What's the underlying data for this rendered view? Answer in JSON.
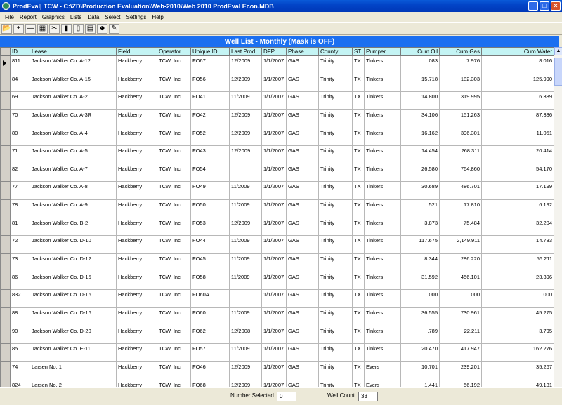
{
  "window": {
    "title": "ProdEval| TCW - C:\\ZD\\Production Evaluation\\Web-2010\\Web 2010 ProdEval Econ.MDB",
    "minimize": "_",
    "maximize": "□",
    "close": "×"
  },
  "menu": [
    "File",
    "Report",
    "Graphics",
    "Lists",
    "Data",
    "Select",
    "Settings",
    "Help"
  ],
  "toolbar": [
    {
      "icon": "open-folder-icon",
      "glyph": "📂"
    },
    {
      "icon": "add-icon",
      "glyph": "+"
    },
    {
      "icon": "remove-icon",
      "glyph": "—"
    },
    {
      "icon": "map-icon",
      "glyph": "▦"
    },
    {
      "icon": "tools-icon",
      "glyph": "✂"
    },
    {
      "icon": "book-icon",
      "glyph": "▮"
    },
    {
      "icon": "notebook-icon",
      "glyph": "▯"
    },
    {
      "icon": "card-icon",
      "glyph": "▤"
    },
    {
      "icon": "users-icon",
      "glyph": "☻"
    },
    {
      "icon": "wand-icon",
      "glyph": "✎"
    }
  ],
  "grid_title": "Well List - Monthly (Mask is OFF)",
  "columns": [
    "ID",
    "Lease",
    "Field",
    "Operator",
    "Unique ID",
    "Last Prod.",
    "DFP",
    "Phase",
    "County",
    "ST",
    "Pumper",
    "Cum Oil",
    "Cum Gas",
    "Cum Water"
  ],
  "rows": [
    [
      "811",
      "Jackson Walker Co. A-12",
      "Hackberry",
      "TCW, Inc",
      "FO67",
      "12/2009",
      "1/1/2007",
      "GAS",
      "Trinity",
      "TX",
      "Tinkers",
      ".083",
      "7.976",
      "8.016"
    ],
    [
      "84",
      "Jackson Walker Co. A-15",
      "Hackberry",
      "TCW, Inc",
      "FO56",
      "12/2009",
      "1/1/2007",
      "GAS",
      "Trinity",
      "TX",
      "Tinkers",
      "15.718",
      "182.303",
      "125.990"
    ],
    [
      "69",
      "Jackson Walker Co. A-2",
      "Hackberry",
      "TCW, Inc",
      "FO41",
      "11/2009",
      "1/1/2007",
      "GAS",
      "Trinity",
      "TX",
      "Tinkers",
      "14.800",
      "319.995",
      "6.389"
    ],
    [
      "70",
      "Jackson Walker Co. A-3R",
      "Hackberry",
      "TCW, Inc",
      "FO42",
      "12/2009",
      "1/1/2007",
      "GAS",
      "Trinity",
      "TX",
      "Tinkers",
      "34.106",
      "151.263",
      "87.336"
    ],
    [
      "80",
      "Jackson Walker Co. A-4",
      "Hackberry",
      "TCW, Inc",
      "FO52",
      "12/2009",
      "1/1/2007",
      "GAS",
      "Trinity",
      "TX",
      "Tinkers",
      "16.162",
      "396.301",
      "11.051"
    ],
    [
      "71",
      "Jackson Walker Co. A-5",
      "Hackberry",
      "TCW, Inc",
      "FO43",
      "12/2009",
      "1/1/2007",
      "GAS",
      "Trinity",
      "TX",
      "Tinkers",
      "14.454",
      "268.311",
      "20.414"
    ],
    [
      "82",
      "Jackson Walker Co. A-7",
      "Hackberry",
      "TCW, Inc",
      "FO54",
      "",
      "1/1/2007",
      "GAS",
      "Trinity",
      "TX",
      "Tinkers",
      "26.580",
      "764.860",
      "54.170"
    ],
    [
      "77",
      "Jackson Walker Co. A-8",
      "Hackberry",
      "TCW, Inc",
      "FO49",
      "11/2009",
      "1/1/2007",
      "GAS",
      "Trinity",
      "TX",
      "Tinkers",
      "30.689",
      "486.701",
      "17.199"
    ],
    [
      "78",
      "Jackson Walker Co. A-9",
      "Hackberry",
      "TCW, Inc",
      "FO50",
      "11/2009",
      "1/1/2007",
      "GAS",
      "Trinity",
      "TX",
      "Tinkers",
      ".521",
      "17.810",
      "6.192"
    ],
    [
      "81",
      "Jackson Walker Co. B-2",
      "Hackberry",
      "TCW, Inc",
      "FO53",
      "12/2009",
      "1/1/2007",
      "GAS",
      "Trinity",
      "TX",
      "Tinkers",
      "3.873",
      "75.484",
      "32.204"
    ],
    [
      "72",
      "Jackson Walker Co. D-10",
      "Hackberry",
      "TCW, Inc",
      "FO44",
      "11/2009",
      "1/1/2007",
      "GAS",
      "Trinity",
      "TX",
      "Tinkers",
      "117.675",
      "2,149.911",
      "14.733"
    ],
    [
      "73",
      "Jackson Walker Co. D-12",
      "Hackberry",
      "TCW, Inc",
      "FO45",
      "11/2009",
      "1/1/2007",
      "GAS",
      "Trinity",
      "TX",
      "Tinkers",
      "8.344",
      "286.220",
      "56.211"
    ],
    [
      "86",
      "Jackson Walker Co. D-15",
      "Hackberry",
      "TCW, Inc",
      "FO58",
      "11/2009",
      "1/1/2007",
      "GAS",
      "Trinity",
      "TX",
      "Tinkers",
      "31.592",
      "456.101",
      "23.396"
    ],
    [
      "832",
      "Jackson Walker Co. D-16",
      "Hackberry",
      "TCW, Inc",
      "FO60A",
      "",
      "1/1/2007",
      "GAS",
      "Trinity",
      "TX",
      "Tinkers",
      ".000",
      ".000",
      ".000"
    ],
    [
      "88",
      "Jackson Walker Co. D-16",
      "Hackberry",
      "TCW, Inc",
      "FO60",
      "11/2009",
      "1/1/2007",
      "GAS",
      "Trinity",
      "TX",
      "Tinkers",
      "36.555",
      "730.961",
      "45.275"
    ],
    [
      "90",
      "Jackson Walker Co. D-20",
      "Hackberry",
      "TCW, Inc",
      "FO62",
      "12/2008",
      "1/1/2007",
      "GAS",
      "Trinity",
      "TX",
      "Tinkers",
      ".789",
      "22.211",
      "3.795"
    ],
    [
      "85",
      "Jackson Walker Co. E-11",
      "Hackberry",
      "TCW, Inc",
      "FO57",
      "11/2009",
      "1/1/2007",
      "GAS",
      "Trinity",
      "TX",
      "Tinkers",
      "20.470",
      "417.947",
      "162.276"
    ],
    [
      "74",
      "Larsen  No. 1",
      "Hackberry",
      "TCW, Inc",
      "FO46",
      "12/2009",
      "1/1/2007",
      "GAS",
      "Trinity",
      "TX",
      "Evers",
      "10.701",
      "239.201",
      "35.267"
    ],
    [
      "824",
      "Larsen  No. 2",
      "Hackberry",
      "TCW, Inc",
      "FO68",
      "12/2009",
      "1/1/2007",
      "GAS",
      "Trinity",
      "TX",
      "Evers",
      "1.441",
      "56.192",
      "49.131"
    ]
  ],
  "status": {
    "selected_label": "Number Selected",
    "selected_value": "0",
    "count_label": "Well Count",
    "count_value": "33"
  }
}
